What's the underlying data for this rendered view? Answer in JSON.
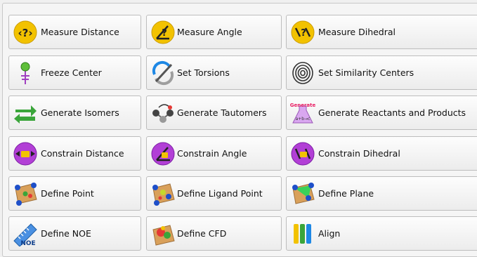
{
  "buttons": [
    {
      "label": "Measure Distance",
      "icon": "measure-distance-icon"
    },
    {
      "label": "Measure Angle",
      "icon": "measure-angle-icon"
    },
    {
      "label": "Measure Dihedral",
      "icon": "measure-dihedral-icon"
    },
    {
      "label": "Freeze Center",
      "icon": "freeze-center-icon"
    },
    {
      "label": "Set Torsions",
      "icon": "set-torsions-icon"
    },
    {
      "label": "Set Similarity Centers",
      "icon": "fingerprint-icon"
    },
    {
      "label": "Generate Isomers",
      "icon": "generate-isomers-icon"
    },
    {
      "label": "Generate Tautomers",
      "icon": "generate-tautomers-icon"
    },
    {
      "label": "Generate Reactants and Products",
      "icon": "generate-flask-icon",
      "icon_text": "Generate",
      "icon_subtext": "a+b→c"
    },
    {
      "label": "Constrain Distance",
      "icon": "constrain-distance-icon"
    },
    {
      "label": "Constrain Angle",
      "icon": "constrain-angle-icon"
    },
    {
      "label": "Constrain Dihedral",
      "icon": "constrain-dihedral-icon"
    },
    {
      "label": "Define Point",
      "icon": "define-point-icon"
    },
    {
      "label": "Define Ligand Point",
      "icon": "define-ligand-point-icon"
    },
    {
      "label": "Define Plane",
      "icon": "define-plane-icon"
    },
    {
      "label": "Define NOE",
      "icon": "define-noe-icon",
      "icon_text": "NOE"
    },
    {
      "label": "Define CFD",
      "icon": "define-cfd-icon"
    },
    {
      "label": "Align",
      "icon": "align-icon"
    }
  ],
  "colors": {
    "yellow": "#f2c200",
    "purple": "#b23fd6",
    "green": "#3aa53a",
    "blue": "#1e6fd0"
  }
}
